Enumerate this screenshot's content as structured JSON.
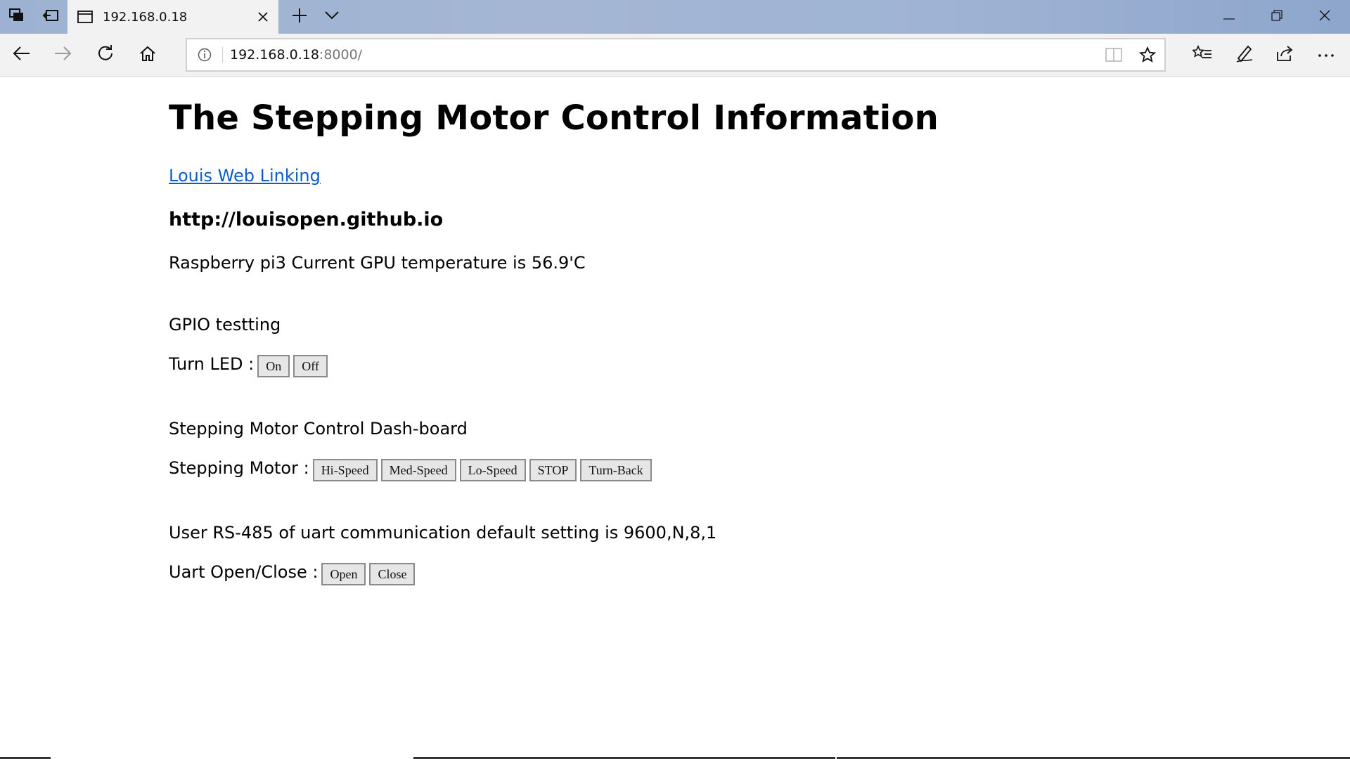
{
  "browser": {
    "tab": {
      "title": "192.168.0.18"
    },
    "address": {
      "host": "192.168.0.18",
      "port": ":8000/"
    },
    "icons": {
      "tab_manager": "tab-manager-icon",
      "set_aside": "set-aside-tabs-icon",
      "tab_page": "page-icon",
      "close_tab": "close-icon",
      "new_tab": "plus-icon",
      "tab_preview": "chevron-down-icon",
      "minimize": "minimize-icon",
      "restore": "restore-icon",
      "close_window": "close-icon",
      "back": "back-arrow-icon",
      "forward": "forward-arrow-icon",
      "refresh": "refresh-icon",
      "home": "home-icon",
      "site_info": "info-icon",
      "reading_view": "reading-view-icon",
      "favorite": "star-icon",
      "favorites_hub": "favorites-list-icon",
      "notes": "pen-icon",
      "share": "share-icon",
      "more": "more-icon"
    }
  },
  "page": {
    "title": "The Stepping Motor Control Information",
    "link_text": "Louis Web Linking",
    "site_url": "http://louisopen.github.io",
    "temperature_text": "Raspberry pi3 Current GPU temperature is 56.9'C",
    "gpio_heading": "GPIO testting",
    "led_row": {
      "label": "Turn LED :",
      "buttons": [
        "On",
        "Off"
      ]
    },
    "motor_heading": "Stepping Motor Control Dash-board",
    "motor_row": {
      "label": "Stepping Motor :",
      "buttons": [
        "Hi-Speed",
        "Med-Speed",
        "Lo-Speed",
        "STOP",
        "Turn-Back"
      ]
    },
    "uart_text": "User RS-485 of uart communication default setting is 9600,N,8,1",
    "uart_row": {
      "label": "Uart Open/Close :",
      "buttons": [
        "Open",
        "Close"
      ]
    }
  }
}
